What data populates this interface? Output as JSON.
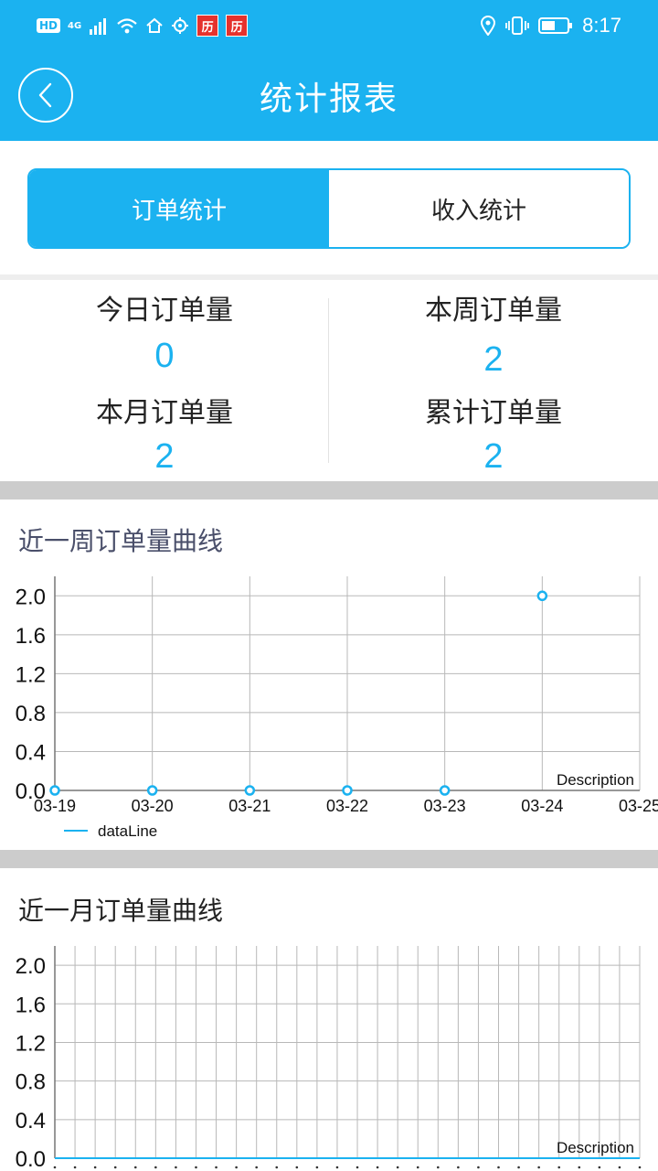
{
  "status_bar": {
    "network_hd": "HD",
    "network_4g": "4G",
    "app_badge_1": "历",
    "app_badge_2": "历",
    "time": "8:17",
    "icons": [
      "signal-icon",
      "wifi-icon",
      "home-icon",
      "location-target-icon",
      "location-pin-icon",
      "vibrate-icon",
      "battery-icon"
    ]
  },
  "nav": {
    "title": "统计报表",
    "back_icon": "back-chevron-icon"
  },
  "tabs": [
    {
      "label": "订单统计",
      "active": true
    },
    {
      "label": "收入统计",
      "active": false
    }
  ],
  "stats": {
    "today_label": "今日订单量",
    "today_value": "0",
    "week_label": "本周订单量",
    "week_value": "2",
    "month_label": "本月订单量",
    "month_value": "2",
    "total_label": "累计订单量",
    "total_value": "2"
  },
  "colors": {
    "accent": "#1bb2f0",
    "band": "#cccccc",
    "grid": "#b8b8b8"
  },
  "week_chart": {
    "section_title": "近一周订单量曲线",
    "description": "Description",
    "chart_data": {
      "type": "line",
      "x": [
        "03-19",
        "03-20",
        "03-21",
        "03-22",
        "03-23",
        "03-24",
        "03-25"
      ],
      "series": [
        {
          "name": "dataLine",
          "values": [
            0,
            0,
            0,
            0,
            0,
            2,
            null
          ]
        }
      ],
      "y_ticks": [
        "0.0",
        "0.4",
        "0.8",
        "1.2",
        "1.6",
        "2.0"
      ],
      "ylim": [
        0,
        2.2
      ],
      "grid": true,
      "legend": "bottom-left"
    }
  },
  "month_chart": {
    "section_title": "近一月订单量曲线",
    "description": "Description",
    "chart_data": {
      "type": "line",
      "x_count": 30,
      "series": [
        {
          "values": [
            0,
            0,
            0,
            0,
            0,
            0,
            0,
            0,
            0,
            0,
            0,
            0,
            0,
            0,
            0,
            0,
            0,
            0,
            0,
            0,
            0,
            0,
            0,
            0,
            0,
            0,
            0,
            0,
            0,
            0
          ]
        }
      ],
      "y_ticks": [
        "0.0",
        "0.4",
        "0.8",
        "1.2",
        "1.6",
        "2.0"
      ],
      "ylim": [
        0,
        2.2
      ],
      "grid": true
    }
  }
}
